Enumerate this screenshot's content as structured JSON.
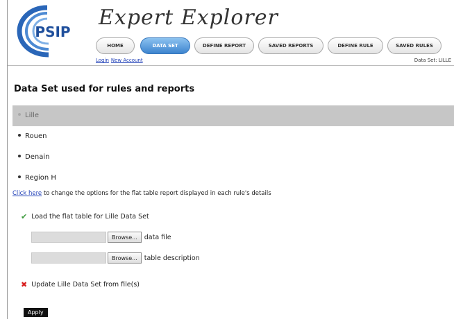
{
  "logo": {
    "text": "PSIP"
  },
  "app_title": "Expert Explorer",
  "nav": {
    "tabs": [
      {
        "label": "HOME",
        "active": false
      },
      {
        "label": "DATA SET",
        "active": true
      },
      {
        "label": "DEFINE REPORT",
        "active": false
      },
      {
        "label": "SAVED REPORTS",
        "active": false
      },
      {
        "label": "DEFINE RULE",
        "active": false
      },
      {
        "label": "SAVED RULES",
        "active": false
      }
    ]
  },
  "auth": {
    "login": "Login",
    "new_account": "New Account"
  },
  "dataset_label": "Data Set: LILLE",
  "section_title": "Data Set used for rules and reports",
  "datasets": [
    {
      "label": "Lille",
      "selected": true
    },
    {
      "label": "Rouen",
      "selected": false
    },
    {
      "label": "Denain",
      "selected": false
    },
    {
      "label": "Region H",
      "selected": false
    }
  ],
  "options": {
    "link": "Click here",
    "text": " to change the options for the flat table report displayed in each rule's details"
  },
  "load_label": "Load the flat table for Lille Data Set",
  "file_inputs": [
    {
      "button": "Browse...",
      "label": "data file"
    },
    {
      "button": "Browse...",
      "label": "table description"
    }
  ],
  "update_label": "Update Lille Data Set from file(s)",
  "apply_label": "Apply",
  "colors": {
    "accent": "#3d84cf",
    "link": "#1f3fb7",
    "check": "#3c9a3c",
    "cross": "#d82020"
  },
  "icons": {
    "check": "check-icon",
    "cross": "cross-icon"
  }
}
